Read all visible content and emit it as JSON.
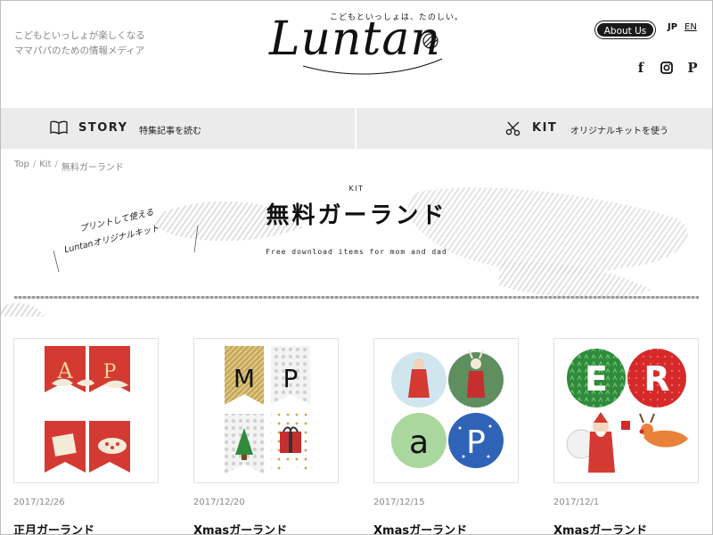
{
  "header": {
    "tagline_line1": "こどもといっしょが楽しくなる",
    "tagline_line2": "ママパパのための情報メディア",
    "logo_text": "Luntan",
    "logo_subtitle": "こどもといっしょは、たのしい。",
    "about_label": "About Us",
    "lang_jp": "JP",
    "lang_en": "EN",
    "social": [
      "facebook-icon",
      "instagram-icon",
      "pinterest-icon"
    ]
  },
  "nav": {
    "story_label": "STORY",
    "story_sub": "特集記事を読む",
    "kit_label": "KIT",
    "kit_sub": "オリジナルキットを使う"
  },
  "breadcrumb": {
    "items": [
      "Top",
      "Kit",
      "無料ガーランド"
    ],
    "separator": "/"
  },
  "hero": {
    "eyebrow": "KIT",
    "title": "無料ガーランド",
    "subtitle": "Free download items for mom and dad",
    "handwritten_line1": "プリントして使える",
    "handwritten_line2": "Luntanオリジナルキット"
  },
  "cards": [
    {
      "date": "2017/12/26",
      "title": "正月ガーランド"
    },
    {
      "date": "2017/12/20",
      "title": "Xmasガーランド"
    },
    {
      "date": "2017/12/15",
      "title": "Xmasガーランド"
    },
    {
      "date": "2017/12/1",
      "title": "Xmasガーランド"
    }
  ],
  "colors": {
    "nav_bg": "#ebebeb",
    "about_bg": "#1a1a1a",
    "newyear_red": "#d43a32",
    "xmas_green": "#2e8b3a",
    "xmas_red": "#d62a2a"
  }
}
